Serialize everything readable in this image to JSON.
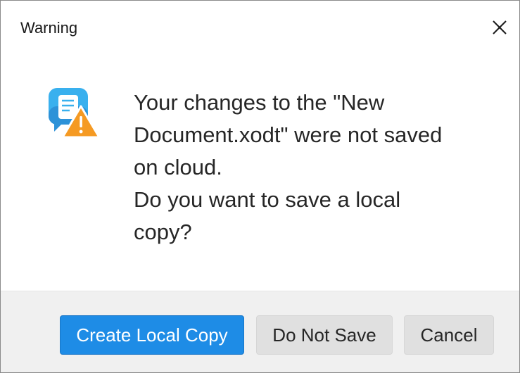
{
  "dialog": {
    "title": "Warning",
    "icon": "cloud-document-warning-icon",
    "message_lines": [
      "Your changes to the \"New",
      "Document.xodt\" were not saved",
      "on cloud.",
      "Do you want to save a local",
      "copy?"
    ],
    "buttons": {
      "create_local_copy": "Create Local Copy",
      "do_not_save": "Do Not Save",
      "cancel": "Cancel"
    }
  },
  "colors": {
    "primary": "#1e8ce6",
    "icon_blue": "#3aa7e8",
    "warning_orange": "#f59a23",
    "footer_bg": "#f0f0f0"
  }
}
